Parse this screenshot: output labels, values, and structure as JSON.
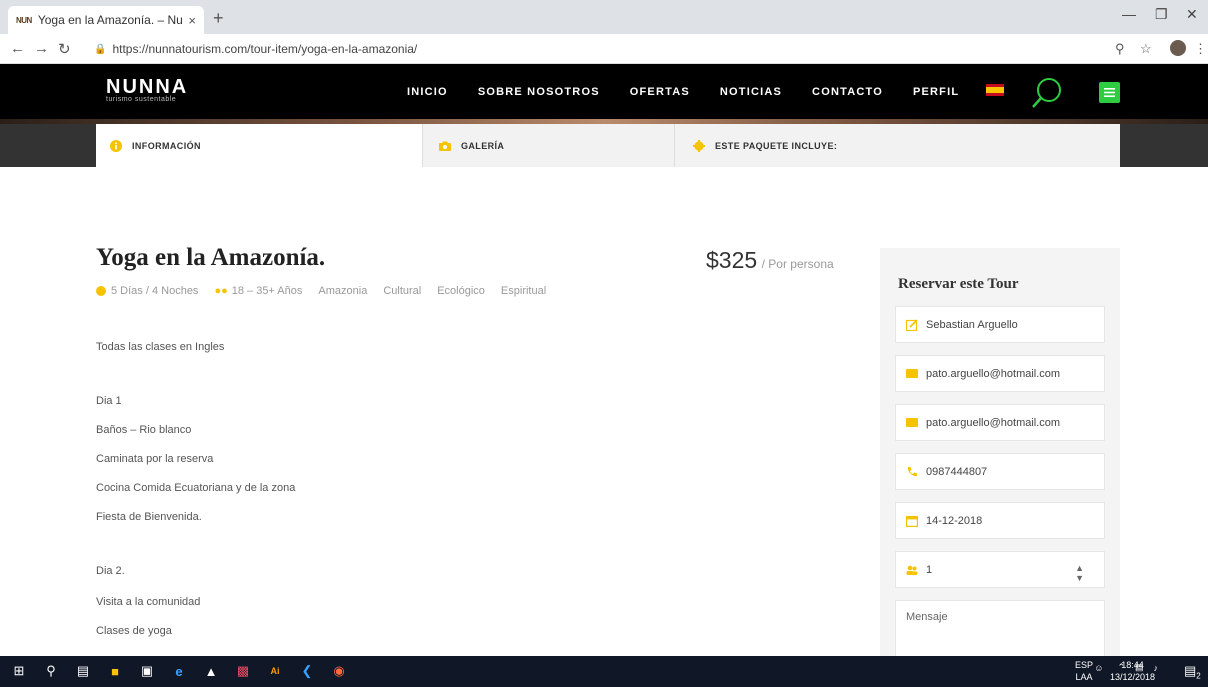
{
  "browser": {
    "tab_title": "Yoga en la Amazonía. – Nunna",
    "favicon_text": "NUN",
    "close_glyph": "×",
    "newtab_glyph": "+",
    "url": "https://nunnatourism.com/tour-item/yoga-en-la-amazonia/"
  },
  "site": {
    "logo": "NUNNA",
    "logo_tagline": "turismo sustentable",
    "nav": [
      "INICIO",
      "SOBRE NOSOTROS",
      "OFERTAS",
      "NOTICIAS",
      "CONTACTO",
      "PERFIL"
    ]
  },
  "page_tabs": [
    {
      "label": "INFORMACIÓN"
    },
    {
      "label": "GALERÍA"
    },
    {
      "label": "ESTE PAQUETE INCLUYE:"
    }
  ],
  "tour": {
    "title": "Yoga en la Amazonía.",
    "price": "$325",
    "price_unit": "/ Por persona",
    "duration": "5 Días / 4 Noches",
    "ages": "18 – 35+ Años",
    "tags": [
      "Amazonia",
      "Cultural",
      "Ecológico",
      "Espiritual"
    ],
    "lines": [
      "Todas las clases en Ingles",
      "Dia 1",
      "Baños – Rio blanco",
      "Caminata por la reserva",
      "Cocina Comida Ecuatoriana y de la zona",
      "Fiesta de Bienvenida.",
      "Dia 2.",
      "Visita a la comunidad",
      "Clases de yoga"
    ]
  },
  "booking": {
    "title": "Reservar este Tour",
    "name": "Sebastian Arguello",
    "email": "pato.arguello@hotmail.com",
    "email_confirm": "pato.arguello@hotmail.com",
    "phone": "0987444807",
    "date": "14-12-2018",
    "people": "1",
    "message_placeholder": "Mensaje"
  },
  "taskbar": {
    "lang_1": "ESP",
    "lang_2": "LAA",
    "time": "18:44",
    "date": "13/12/2018",
    "notif_count": "2"
  },
  "colors": {
    "accent": "#f6c300",
    "search_green": "#2ecc40",
    "header_bg": "#000000"
  }
}
